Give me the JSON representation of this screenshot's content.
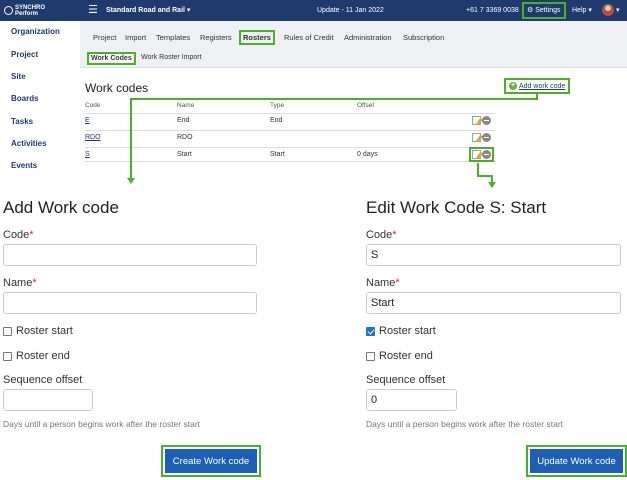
{
  "topbar": {
    "logo_line1": "SYNCHRO",
    "logo_line2": "Perform",
    "project": "Standard Road and Rail ▾",
    "update": "Update - 11 Jan 2022",
    "phone": "+61 7 3369 0038",
    "settings": "⚙ Settings",
    "help": "Help ▾",
    "avatar_caret": "▾"
  },
  "sidebar": [
    "Organization",
    "Project",
    "Site",
    "Boards",
    "Tasks",
    "Activities",
    "Events"
  ],
  "tabs": [
    "Project",
    "Import",
    "Templates",
    "Registers",
    "Rosters",
    "Rules of Credit",
    "Administration",
    "Subscription"
  ],
  "subtabs": [
    "Work Codes",
    "Work Roster Import"
  ],
  "work_codes": {
    "title": "Work codes",
    "add_link": "Add work code",
    "columns": [
      "Code",
      "Name",
      "Type",
      "Offset"
    ],
    "rows": [
      {
        "code": "E",
        "name": "End",
        "type": "End",
        "offset": ""
      },
      {
        "code": "RDO",
        "name": "RDO",
        "type": "",
        "offset": ""
      },
      {
        "code": "S",
        "name": "Start",
        "type": "Start",
        "offset": "0 days"
      }
    ]
  },
  "add_form": {
    "title": "Add Work code",
    "code_label": "Code",
    "code_value": "",
    "name_label": "Name",
    "name_value": "",
    "roster_start": "Roster start",
    "roster_end": "Roster end",
    "offset_label": "Sequence offset",
    "offset_value": "",
    "help": "Days until a person begins work after the roster start",
    "button": "Create Work code"
  },
  "edit_form": {
    "title": "Edit Work Code S: Start",
    "code_label": "Code",
    "code_value": "S",
    "name_label": "Name",
    "name_value": "Start",
    "roster_start": "Roster start",
    "roster_end": "Roster end",
    "offset_label": "Sequence offset",
    "offset_value": "0",
    "help": "Days until a person begins work after the roster start",
    "button": "Update Work code"
  },
  "required_mark": "*"
}
